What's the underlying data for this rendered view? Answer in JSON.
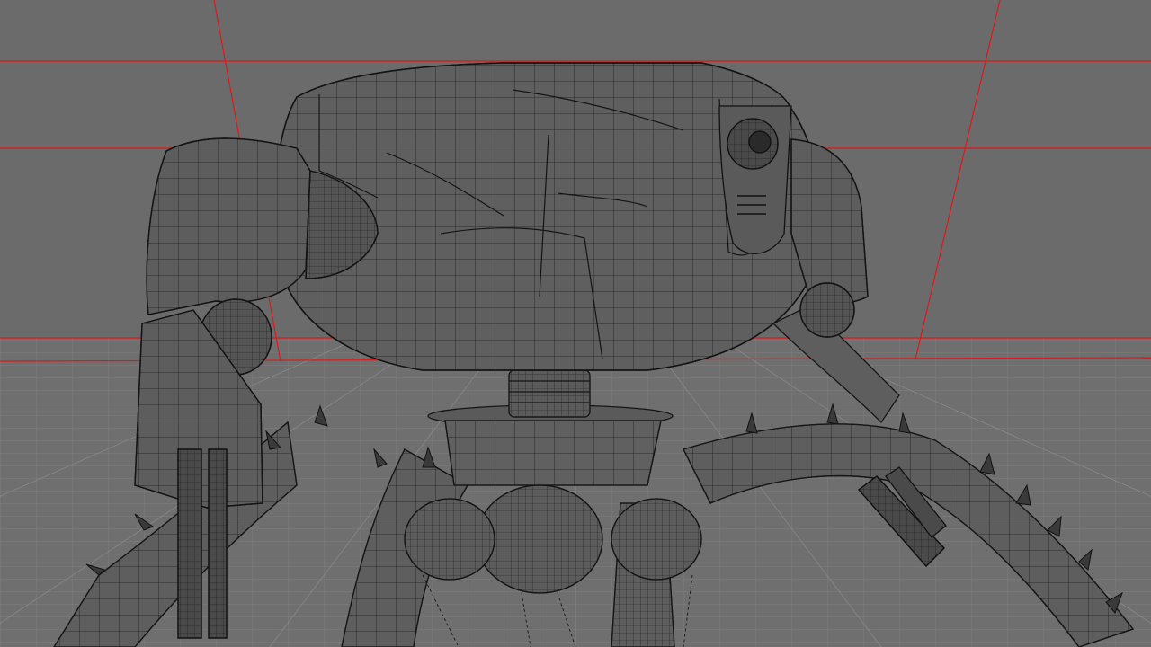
{
  "viewport": {
    "background_color": "#6b6b6b",
    "floor_color": "#6e6e6e",
    "grid_color": "#8a8a8a",
    "guide_color": "#e02020",
    "wire_color": "#1a1a1a",
    "mesh_fill_color": "#626262",
    "grid_shown": true,
    "render_mode": "wireframe"
  },
  "model": {
    "parts": [
      "body",
      "eye",
      "vent",
      "left-shoulder-pod",
      "right-shoulder-pod",
      "left-gun",
      "right-gun",
      "neck-joint",
      "hip-turret",
      "tentacle-legs"
    ]
  }
}
